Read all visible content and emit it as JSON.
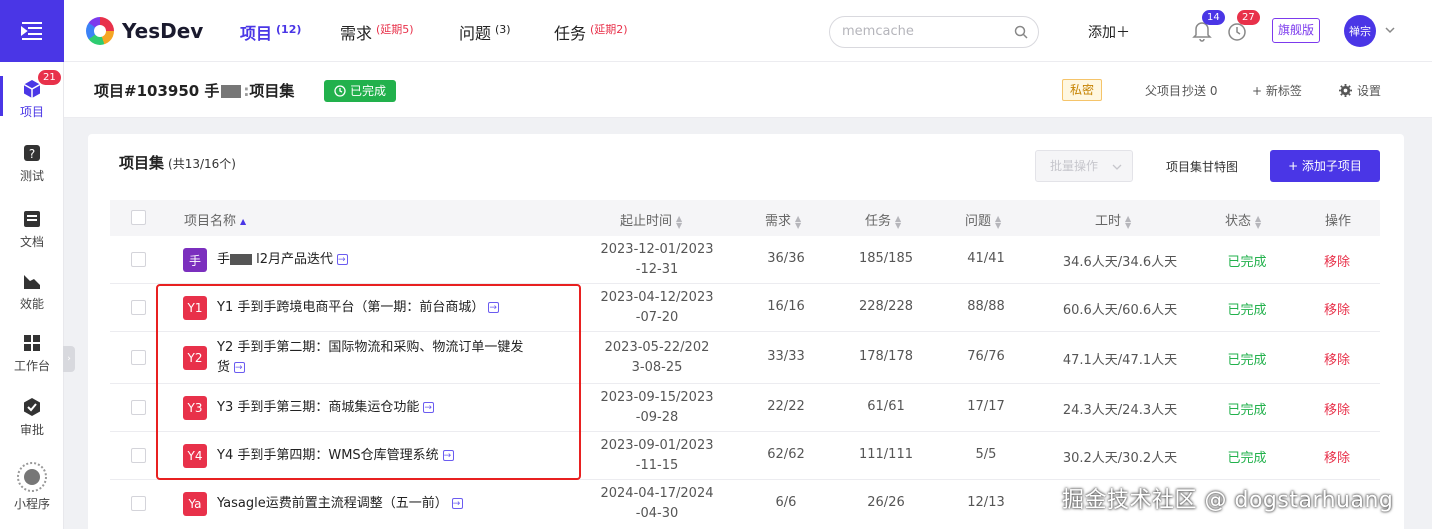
{
  "rail": {
    "items": [
      {
        "label": "项目",
        "badge": "21",
        "icon": "cube-icon"
      },
      {
        "label": "测试",
        "icon": "test-icon"
      },
      {
        "label": "文档",
        "icon": "doc-icon"
      },
      {
        "label": "效能",
        "icon": "chart-icon"
      },
      {
        "label": "工作台",
        "icon": "workspace-icon"
      },
      {
        "label": "审批",
        "icon": "approve-icon"
      },
      {
        "label": "小程序",
        "icon": "miniprogram-icon"
      }
    ]
  },
  "topbar": {
    "brand": "YesDev",
    "nav": [
      {
        "label": "项目",
        "count": "(12)"
      },
      {
        "label": "需求",
        "count": "(延期5)"
      },
      {
        "label": "问题",
        "count": "(3)"
      },
      {
        "label": "任务",
        "count": "(延期2)"
      }
    ],
    "search_placeholder": "memcache",
    "add_label": "添加＋",
    "bell_badge": "14",
    "clock_badge": "27",
    "edition": "旗舰版",
    "avatar": "禅宗"
  },
  "subhead": {
    "title_prefix": "项目#103950 手",
    "title_suffix": "项目集",
    "status": "已完成",
    "private": "私密",
    "parent": "父项目",
    "cc": "抄送 0",
    "new_tag": "+ 新标签",
    "settings": "设置"
  },
  "card": {
    "title": "项目集",
    "count": "(共13/16个)",
    "batch": "批量操作",
    "gantt": "项目集甘特图",
    "add_child": "+ 添加子项目"
  },
  "table": {
    "headers": [
      "项目名称",
      "起止时间",
      "需求",
      "任务",
      "问题",
      "工时",
      "状态",
      "操作"
    ],
    "rows": [
      {
        "badge": "手",
        "color": "#7b2fbe",
        "name_a": "手",
        "name_b": "l2月产品迭代",
        "date1": "2023-12-01/2023",
        "date2": "-12-31",
        "req": "36/36",
        "task": "185/185",
        "issue": "41/41",
        "hours": "34.6人天/34.6人天",
        "status": "已完成",
        "op": "移除"
      },
      {
        "badge": "Y1",
        "color": "#e8314a",
        "name": "Y1 手到手跨境电商平台（第一期：前台商城）",
        "date1": "2023-04-12/2023",
        "date2": "-07-20",
        "req": "16/16",
        "task": "228/228",
        "issue": "88/88",
        "hours": "60.6人天/60.6人天",
        "status": "已完成",
        "op": "移除"
      },
      {
        "badge": "Y2",
        "color": "#e8314a",
        "name": "Y2 手到手第二期：国际物流和采购、物流订单一键发",
        "name2": "货",
        "date1": "2023-05-22/202",
        "date2": "3-08-25",
        "req": "33/33",
        "task": "178/178",
        "issue": "76/76",
        "hours": "47.1人天/47.1人天",
        "status": "已完成",
        "op": "移除"
      },
      {
        "badge": "Y3",
        "color": "#e8314a",
        "name": "Y3 手到手第三期：商城集运仓功能",
        "date1": "2023-09-15/2023",
        "date2": "-09-28",
        "req": "22/22",
        "task": "61/61",
        "issue": "17/17",
        "hours": "24.3人天/24.3人天",
        "status": "已完成",
        "op": "移除"
      },
      {
        "badge": "Y4",
        "color": "#e8314a",
        "name": "Y4 手到手第四期：WMS仓库管理系统",
        "date1": "2023-09-01/2023",
        "date2": "-11-15",
        "req": "62/62",
        "task": "111/111",
        "issue": "5/5",
        "hours": "30.2人天/30.2人天",
        "status": "已完成",
        "op": "移除"
      },
      {
        "badge": "Ya",
        "color": "#e8314a",
        "name": "Yasagle运费前置主流程调整（五一前）",
        "date1": "2024-04-17/2024",
        "date2": "-04-30",
        "req": "6/6",
        "task": "26/26",
        "issue": "12/13",
        "hours": "",
        "status": "",
        "op": ""
      }
    ]
  },
  "watermark": "掘金技术社区 @ dogstarhuang"
}
